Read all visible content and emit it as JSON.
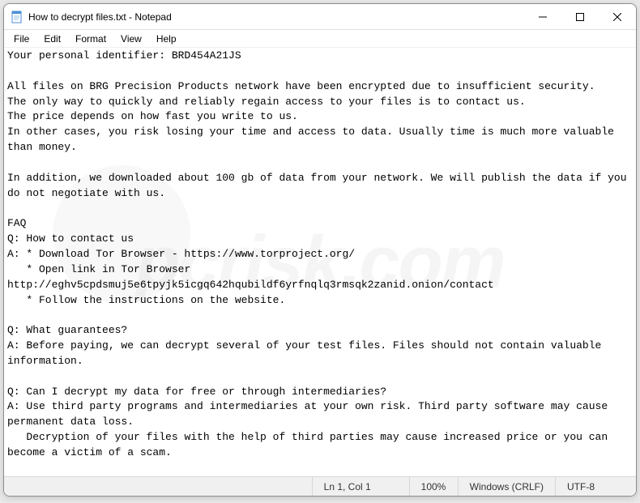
{
  "titlebar": {
    "title": "How to decrypt files.txt - Notepad"
  },
  "menu": {
    "file": "File",
    "edit": "Edit",
    "format": "Format",
    "view": "View",
    "help": "Help"
  },
  "document": {
    "text": "Your personal identifier: BRD454A21JS\n\nAll files on BRG Precision Products network have been encrypted due to insufficient security.\nThe only way to quickly and reliably regain access to your files is to contact us.\nThe price depends on how fast you write to us.\nIn other cases, you risk losing your time and access to data. Usually time is much more valuable than money.\n\nIn addition, we downloaded about 100 gb of data from your network. We will publish the data if you do not negotiate with us.\n\nFAQ\nQ: How to contact us\nA: * Download Tor Browser - https://www.torproject.org/\n   * Open link in Tor Browser http://eghv5cpdsmuj5e6tpyjk5icgq642hqubildf6yrfnqlq3rmsqk2zanid.onion/contact\n   * Follow the instructions on the website.\n\nQ: What guarantees?\nA: Before paying, we can decrypt several of your test files. Files should not contain valuable information.\n\nQ: Can I decrypt my data for free or through intermediaries?\nA: Use third party programs and intermediaries at your own risk. Third party software may cause permanent data loss.\n   Decryption of your files with the help of third parties may cause increased price or you can become a victim of a scam."
  },
  "statusbar": {
    "position": "Ln 1, Col 1",
    "zoom": "100%",
    "lineending": "Windows (CRLF)",
    "encoding": "UTF-8"
  },
  "watermark": "pcrisk.com"
}
